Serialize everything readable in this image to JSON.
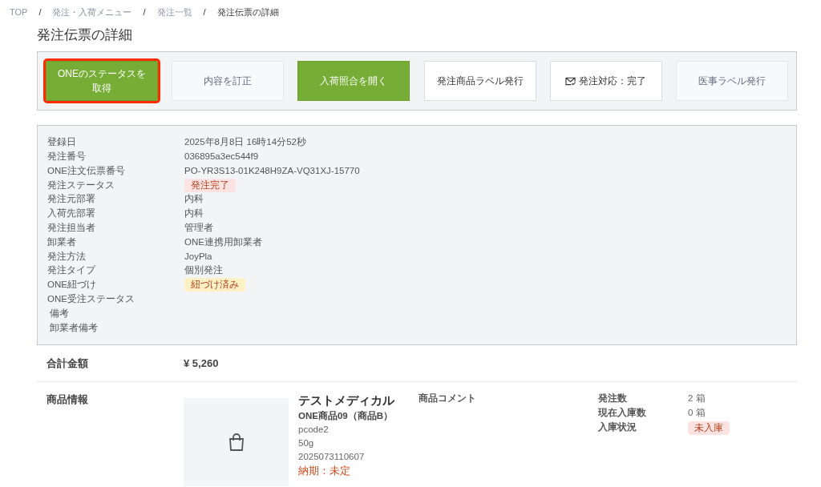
{
  "breadcrumb": [
    {
      "label": "TOP",
      "current": false
    },
    {
      "label": "発注・入荷メニュー",
      "current": false
    },
    {
      "label": "発注一覧",
      "current": false
    },
    {
      "label": "発注伝票の詳細",
      "current": true
    }
  ],
  "separator": "/",
  "title": "発注伝票の詳細",
  "actions": [
    {
      "label": "ONEのステータスを取得",
      "kind": "primary",
      "highlighted": true
    },
    {
      "label": "内容を訂正",
      "kind": "muted",
      "highlighted": false
    },
    {
      "label": "入荷照合を開く",
      "kind": "primary",
      "highlighted": false
    },
    {
      "label": "発注商品ラベル発行",
      "kind": "default",
      "highlighted": false
    },
    {
      "label": "発注対応：完了",
      "kind": "mail",
      "highlighted": false
    },
    {
      "label": "医事ラベル発行",
      "kind": "muted",
      "highlighted": false
    }
  ],
  "details": [
    {
      "label": "登録日",
      "value": "2025年8月8日 16時14分52秒",
      "kind": "text"
    },
    {
      "label": "発注番号",
      "value": "036895a3ec544f9",
      "kind": "text"
    },
    {
      "label": "ONE注文伝票番号",
      "value": "PO-YR3S13-01K248H9ZA-VQ31XJ-15770",
      "kind": "text"
    },
    {
      "label": "発注ステータス",
      "value": "発注完了",
      "kind": "badge",
      "color": "#fde2e2"
    },
    {
      "label": "発注元部署",
      "value": "内科",
      "kind": "text"
    },
    {
      "label": "入荷先部署",
      "value": "内科",
      "kind": "text"
    },
    {
      "label": "発注担当者",
      "value": "管理者",
      "kind": "text"
    },
    {
      "label": "卸業者",
      "value": "ONE連携用卸業者",
      "kind": "text"
    },
    {
      "label": "発注方法",
      "value": "JoyPla",
      "kind": "text"
    },
    {
      "label": "発注タイプ",
      "value": "個別発注",
      "kind": "text"
    },
    {
      "label": "ONE紐づけ",
      "value": "紐づけ済み",
      "kind": "badge",
      "color": "#fdf0c4"
    },
    {
      "label": "ONE受注ステータス"
    },
    {
      "label": " 備考"
    },
    {
      "label": " 卸業者備考"
    }
  ],
  "total": {
    "label": "合計金額",
    "value": "¥ 5,260"
  },
  "products": {
    "label": "商品情報",
    "items": [
      {
        "maker": "テストメディカル",
        "name": "ONE商品09（商品B）",
        "code": "pcode2",
        "spec": "50g",
        "jan": "2025073110607",
        "delivery": "納期：未定",
        "comment_label": "商品コメント",
        "stats": [
          {
            "label": "発注数",
            "value": "2 箱",
            "kind": "text"
          },
          {
            "label": "現在入庫数",
            "value": "0 箱",
            "kind": "text"
          },
          {
            "label": "入庫状況",
            "value": "未入庫",
            "kind": "badge",
            "color": "#fde2e2"
          }
        ]
      }
    ]
  }
}
